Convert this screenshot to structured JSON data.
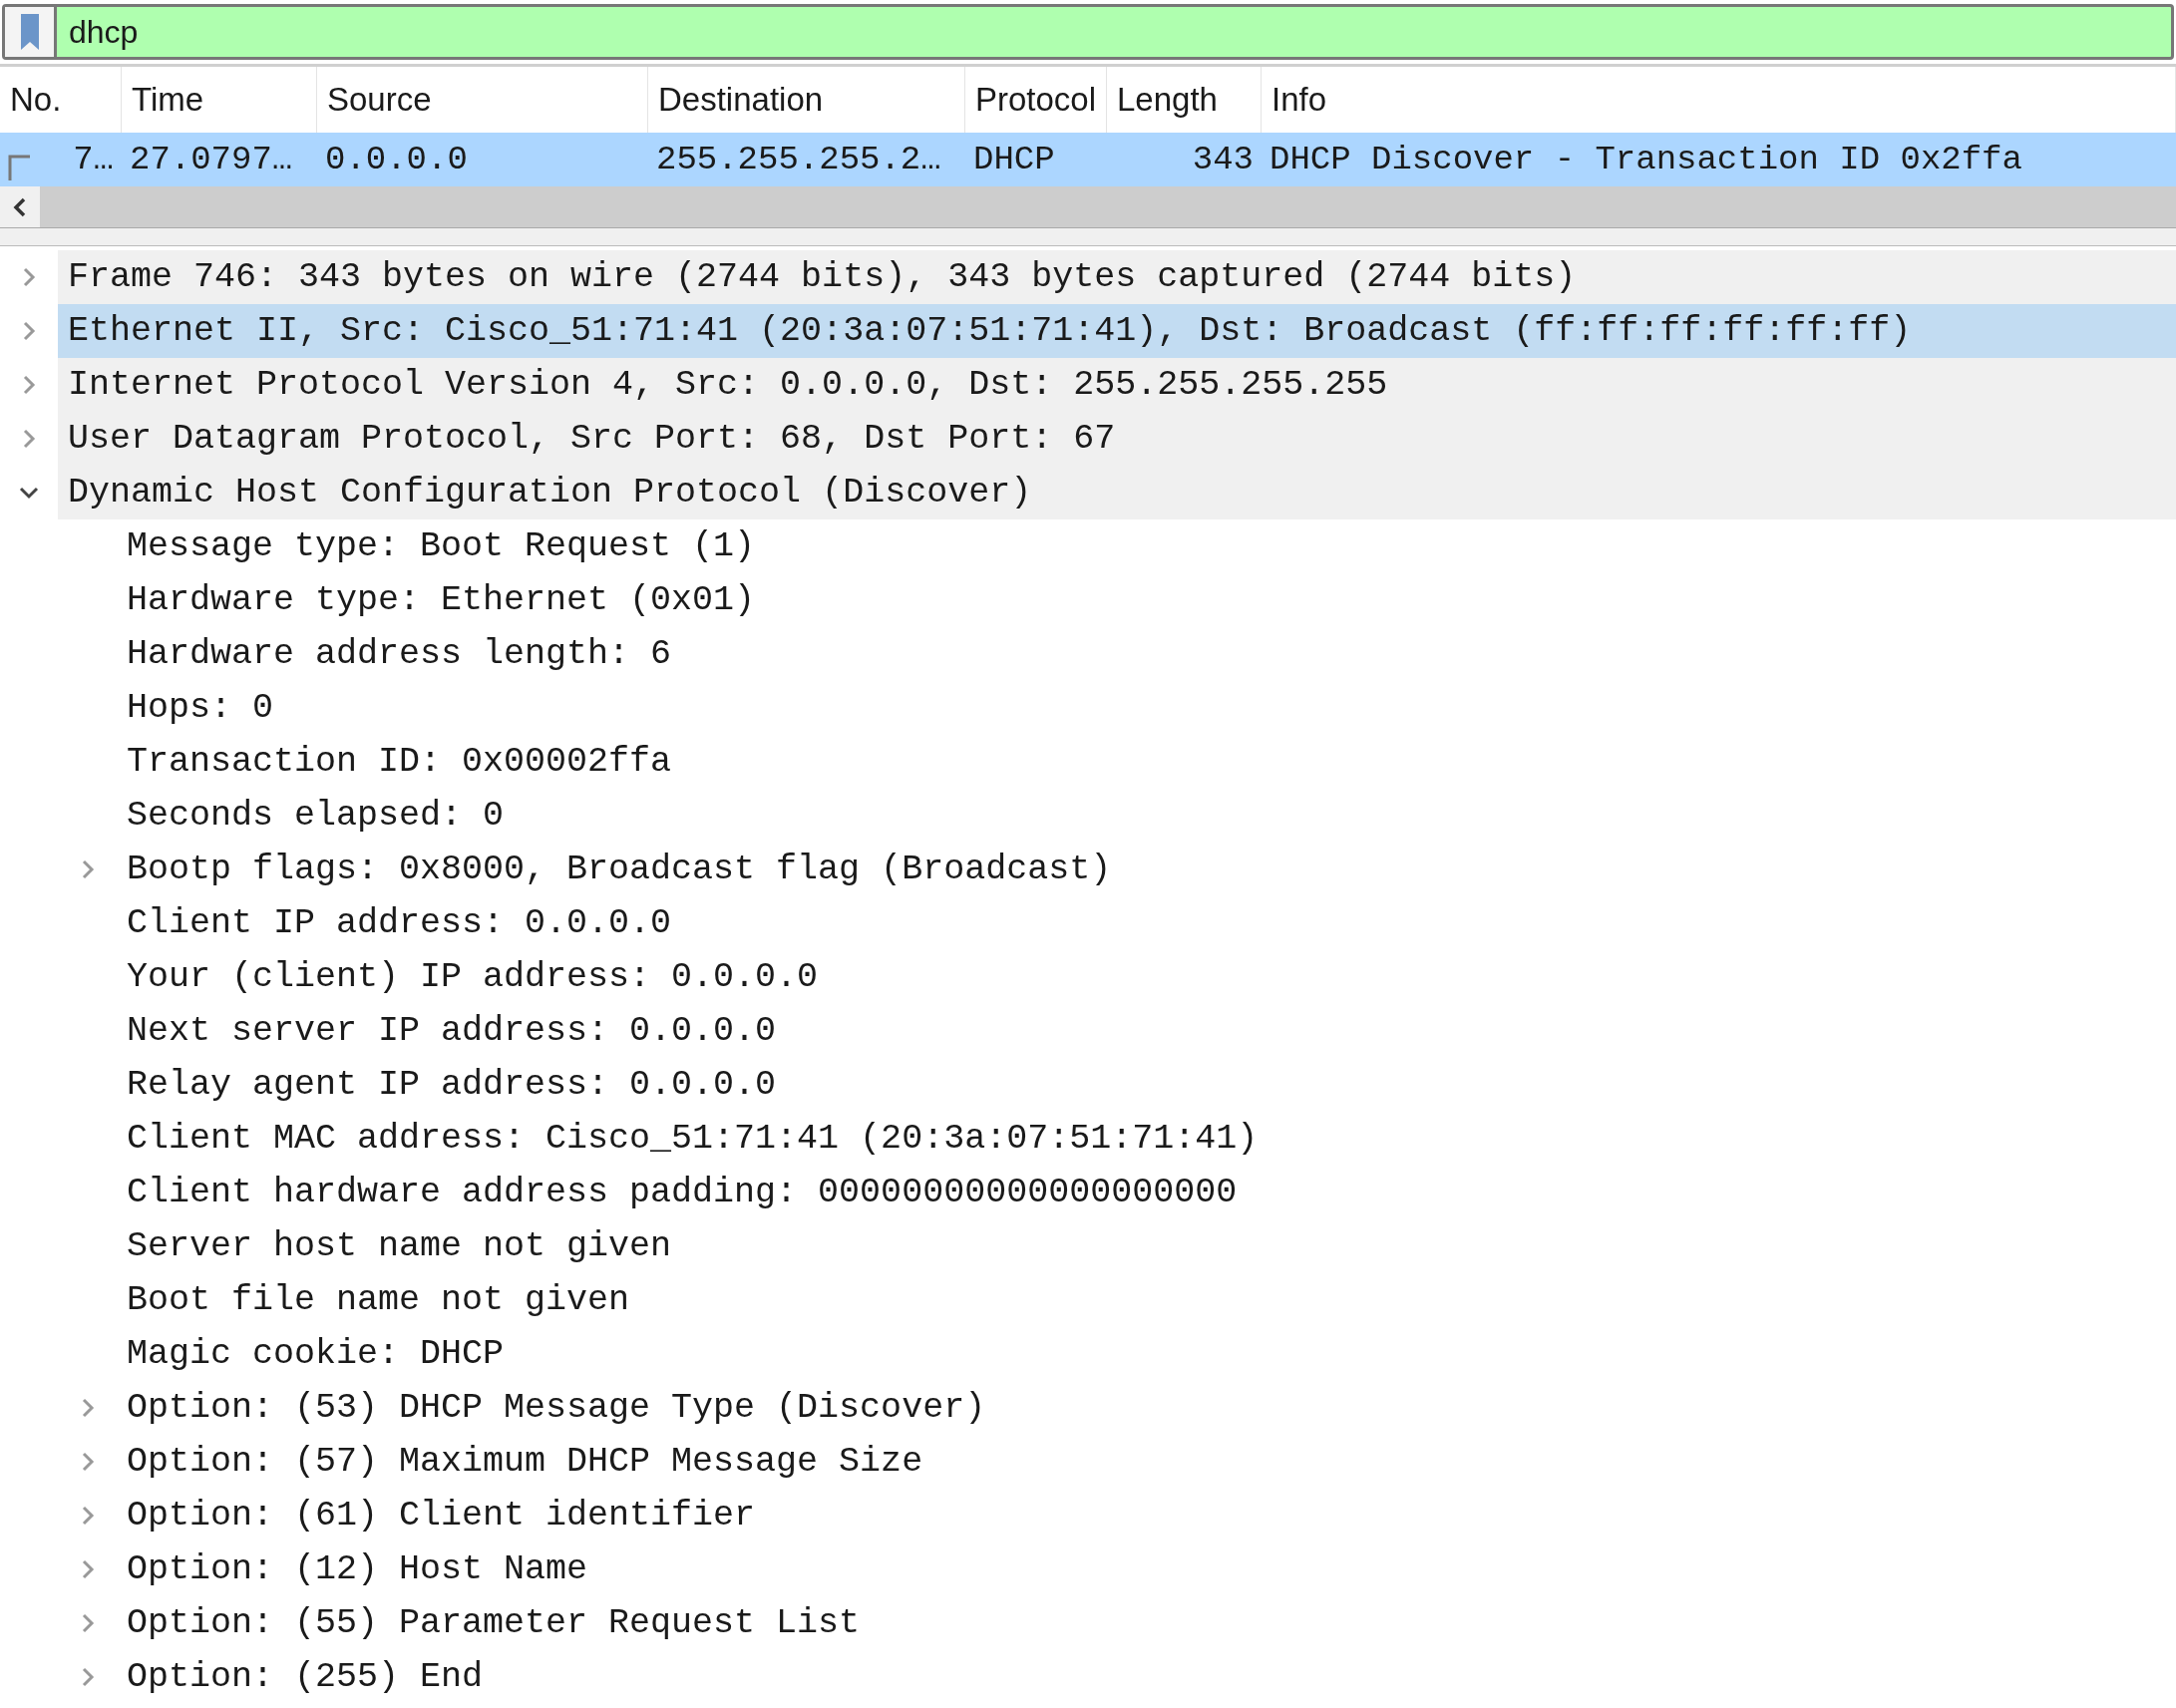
{
  "filter": {
    "value": "dhcp"
  },
  "packet_list": {
    "columns": [
      "No.",
      "Time",
      "Source",
      "Destination",
      "Protocol",
      "Length",
      "Info"
    ],
    "rows": [
      {
        "selected": true,
        "cells": [
          "7…",
          "27.0797…",
          "0.0.0.0",
          "255.255.255.2…",
          "DHCP",
          "343",
          "DHCP Discover - Transaction ID 0x2ffa"
        ]
      }
    ]
  },
  "details": [
    {
      "text": "Frame 746: 343 bytes on wire (2744 bits), 343 bytes captured (2744 bits)",
      "expanded": false,
      "selected": false
    },
    {
      "text": "Ethernet II, Src: Cisco_51:71:41 (20:3a:07:51:71:41), Dst: Broadcast (ff:ff:ff:ff:ff:ff)",
      "expanded": false,
      "selected": true
    },
    {
      "text": "Internet Protocol Version 4, Src: 0.0.0.0, Dst: 255.255.255.255",
      "expanded": false,
      "selected": false
    },
    {
      "text": "User Datagram Protocol, Src Port: 68, Dst Port: 67",
      "expanded": false,
      "selected": false
    },
    {
      "text": "Dynamic Host Configuration Protocol (Discover)",
      "expanded": true,
      "selected": false,
      "children": [
        {
          "text": "Message type: Boot Request (1)",
          "expandable": false
        },
        {
          "text": "Hardware type: Ethernet (0x01)",
          "expandable": false
        },
        {
          "text": "Hardware address length: 6",
          "expandable": false
        },
        {
          "text": "Hops: 0",
          "expandable": false
        },
        {
          "text": "Transaction ID: 0x00002ffa",
          "expandable": false
        },
        {
          "text": "Seconds elapsed: 0",
          "expandable": false
        },
        {
          "text": "Bootp flags: 0x8000, Broadcast flag (Broadcast)",
          "expandable": true
        },
        {
          "text": "Client IP address: 0.0.0.0",
          "expandable": false
        },
        {
          "text": "Your (client) IP address: 0.0.0.0",
          "expandable": false
        },
        {
          "text": "Next server IP address: 0.0.0.0",
          "expandable": false
        },
        {
          "text": "Relay agent IP address: 0.0.0.0",
          "expandable": false
        },
        {
          "text": "Client MAC address: Cisco_51:71:41 (20:3a:07:51:71:41)",
          "expandable": false
        },
        {
          "text": "Client hardware address padding: 00000000000000000000",
          "expandable": false
        },
        {
          "text": "Server host name not given",
          "expandable": false
        },
        {
          "text": "Boot file name not given",
          "expandable": false
        },
        {
          "text": "Magic cookie: DHCP",
          "expandable": false
        },
        {
          "text": "Option: (53) DHCP Message Type (Discover)",
          "expandable": true
        },
        {
          "text": "Option: (57) Maximum DHCP Message Size",
          "expandable": true
        },
        {
          "text": "Option: (61) Client identifier",
          "expandable": true
        },
        {
          "text": "Option: (12) Host Name",
          "expandable": true
        },
        {
          "text": "Option: (55) Parameter Request List",
          "expandable": true
        },
        {
          "text": "Option: (255) End",
          "expandable": true
        }
      ]
    }
  ]
}
